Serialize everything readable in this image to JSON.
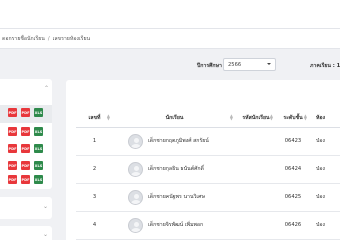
{
  "breadcrumb": [
    "ดอกรายชื่อนักเรียน",
    "เลขรายห้องเรียน"
  ],
  "filters": {
    "year_label": "ปีการศึกษา :",
    "year_value": "2566",
    "term_label": "ภาคเรียน : 1"
  },
  "sidebar_icons": [
    [
      "PDF",
      "PDF",
      "XLS"
    ],
    [
      "PDF",
      "PDF",
      "XLS"
    ],
    [
      "PDF",
      "PDF",
      "XLS"
    ],
    [
      "PDF",
      "PDF",
      "XLS"
    ],
    [
      "PDF",
      "PDF",
      "XLS"
    ]
  ],
  "table": {
    "headers": [
      "เลขที่",
      "นักเรียน",
      "รหัสนักเรียน",
      "ระดับชั้น",
      "ห้อง"
    ],
    "rows": [
      {
        "no": "1",
        "name": "เด็กชายกฤตภูมิพงศ์ สกรัยน์",
        "id": "06423",
        "room": "ป่อง"
      },
      {
        "no": "2",
        "name": "เด็กชายกุลธิน ธนันต์ศักดิ์",
        "id": "06424",
        "room": "ป่อง"
      },
      {
        "no": "3",
        "name": "เด็กชายคนัฐพร นานวิเศษ",
        "id": "06425",
        "room": "ป่อง"
      },
      {
        "no": "4",
        "name": "เด็กชายจิรพัฒน์ เพิ่มพอก",
        "id": "06426",
        "room": "ป่อง"
      }
    ]
  }
}
